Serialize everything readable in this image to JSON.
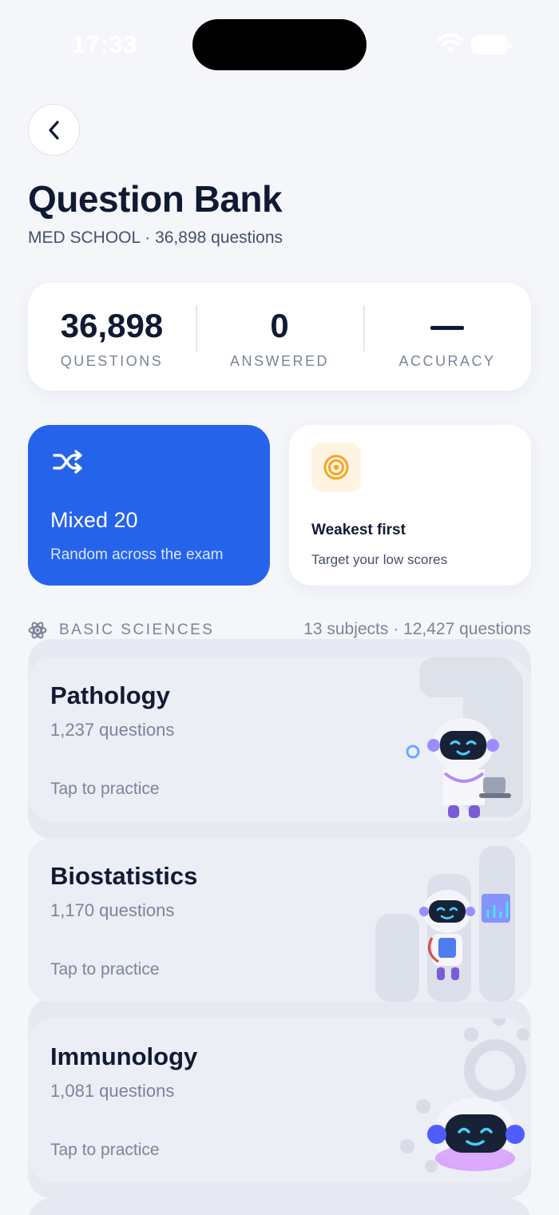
{
  "status_bar": {
    "time": "17:33"
  },
  "header": {
    "title": "Question Bank",
    "subtitle": "MED SCHOOL · 36,898 questions"
  },
  "stats": [
    {
      "value": "36,898",
      "label": "QUESTIONS"
    },
    {
      "value": "0",
      "label": "ANSWERED"
    },
    {
      "value": "",
      "label": "ACCURACY",
      "placeholder": "dash"
    }
  ],
  "modes": {
    "mixed": {
      "title": "Mixed 20",
      "subtitle": "Random across the exam",
      "color": "#2563eb"
    },
    "weak": {
      "title": "Weakest first",
      "subtitle": "Target your low scores",
      "icon_color": "#f5a623"
    }
  },
  "section": {
    "title": "BASIC SCIENCES",
    "meta": "13 subjects · 12,427 questions",
    "icon": "atom-icon"
  },
  "subjects": [
    {
      "name": "Pathology",
      "count": "1,237 questions",
      "cta": "Tap to practice",
      "art": "robot-doctor-microscope"
    },
    {
      "name": "Biostatistics",
      "count": "1,170 questions",
      "cta": "Tap to practice",
      "art": "robot-doctor-chart"
    },
    {
      "name": "Immunology",
      "count": "1,081 questions",
      "cta": "Tap to practice",
      "art": "robot-head"
    }
  ]
}
